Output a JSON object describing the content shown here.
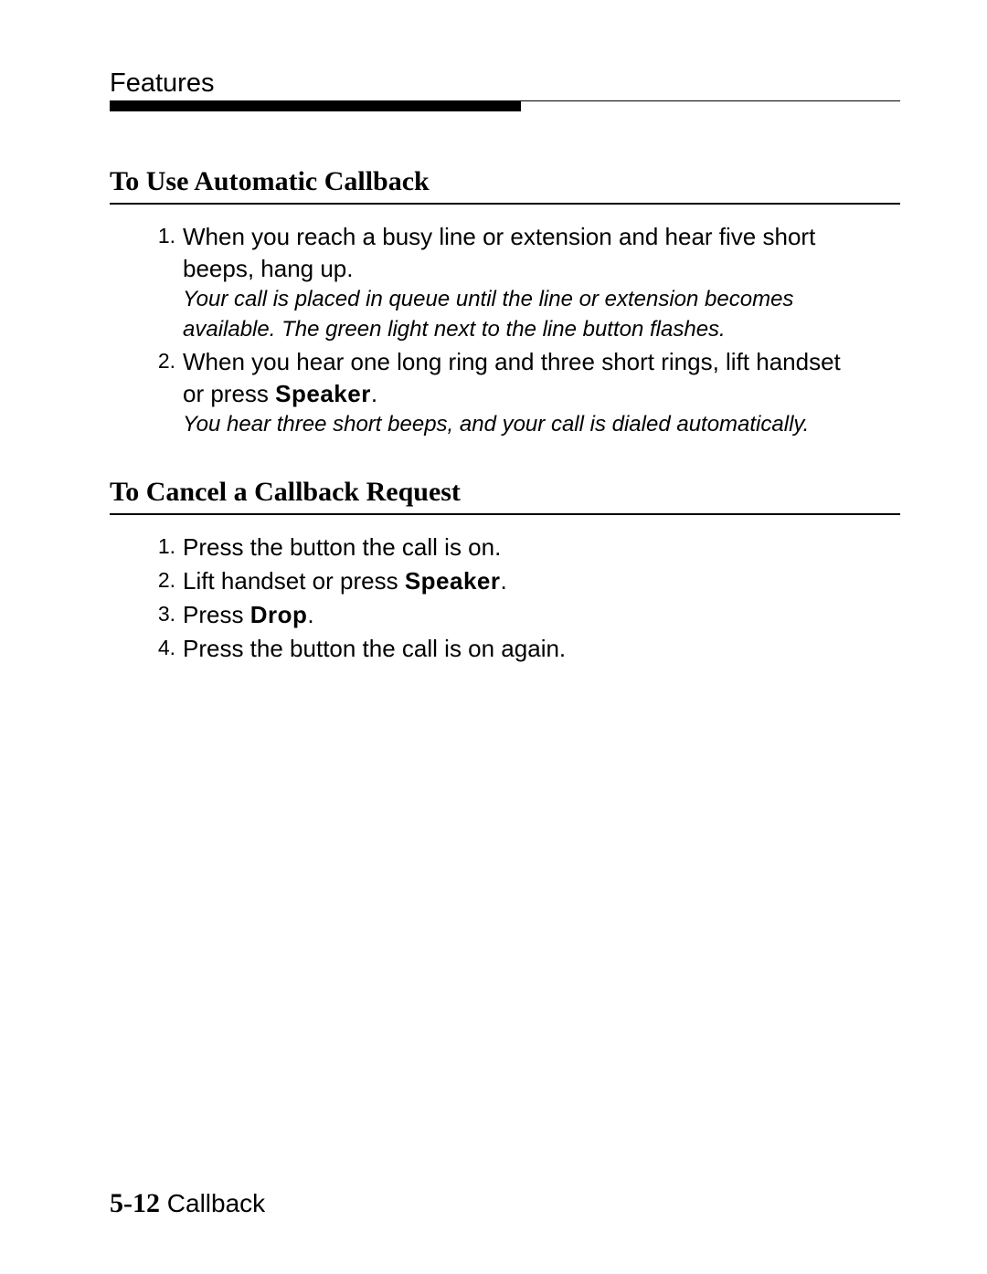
{
  "header": {
    "title": "Features"
  },
  "sections": [
    {
      "heading": "To  Use  Automatic  Callback",
      "items": [
        {
          "marker": "1.",
          "text_parts": [
            "When you reach a busy line or extension and hear five short beeps, hang up."
          ],
          "note": "Your call is placed in queue until the line or extension becomes available. The green light next to the line button flashes."
        },
        {
          "marker": "2.",
          "text_parts": [
            "When you hear one long ring and three short rings, lift handset or press ",
            {
              "keycap": "Speaker"
            },
            "."
          ],
          "note": "You hear three short beeps, and your call is dialed automatically."
        }
      ]
    },
    {
      "heading": "To Cancel a Callback Request",
      "items": [
        {
          "marker": "1.",
          "text_parts": [
            "Press the button the call is on."
          ]
        },
        {
          "marker": "2.",
          "text_parts": [
            "Lift handset or press ",
            {
              "keycap": "Speaker"
            },
            "."
          ]
        },
        {
          "marker": "3.",
          "text_parts": [
            "Press ",
            {
              "keycap": "Drop"
            },
            "."
          ]
        },
        {
          "marker": "4.",
          "text_parts": [
            "Press the button the call is on again."
          ]
        }
      ]
    }
  ],
  "footer": {
    "page_number": "5-12",
    "section_name": "Callback"
  }
}
